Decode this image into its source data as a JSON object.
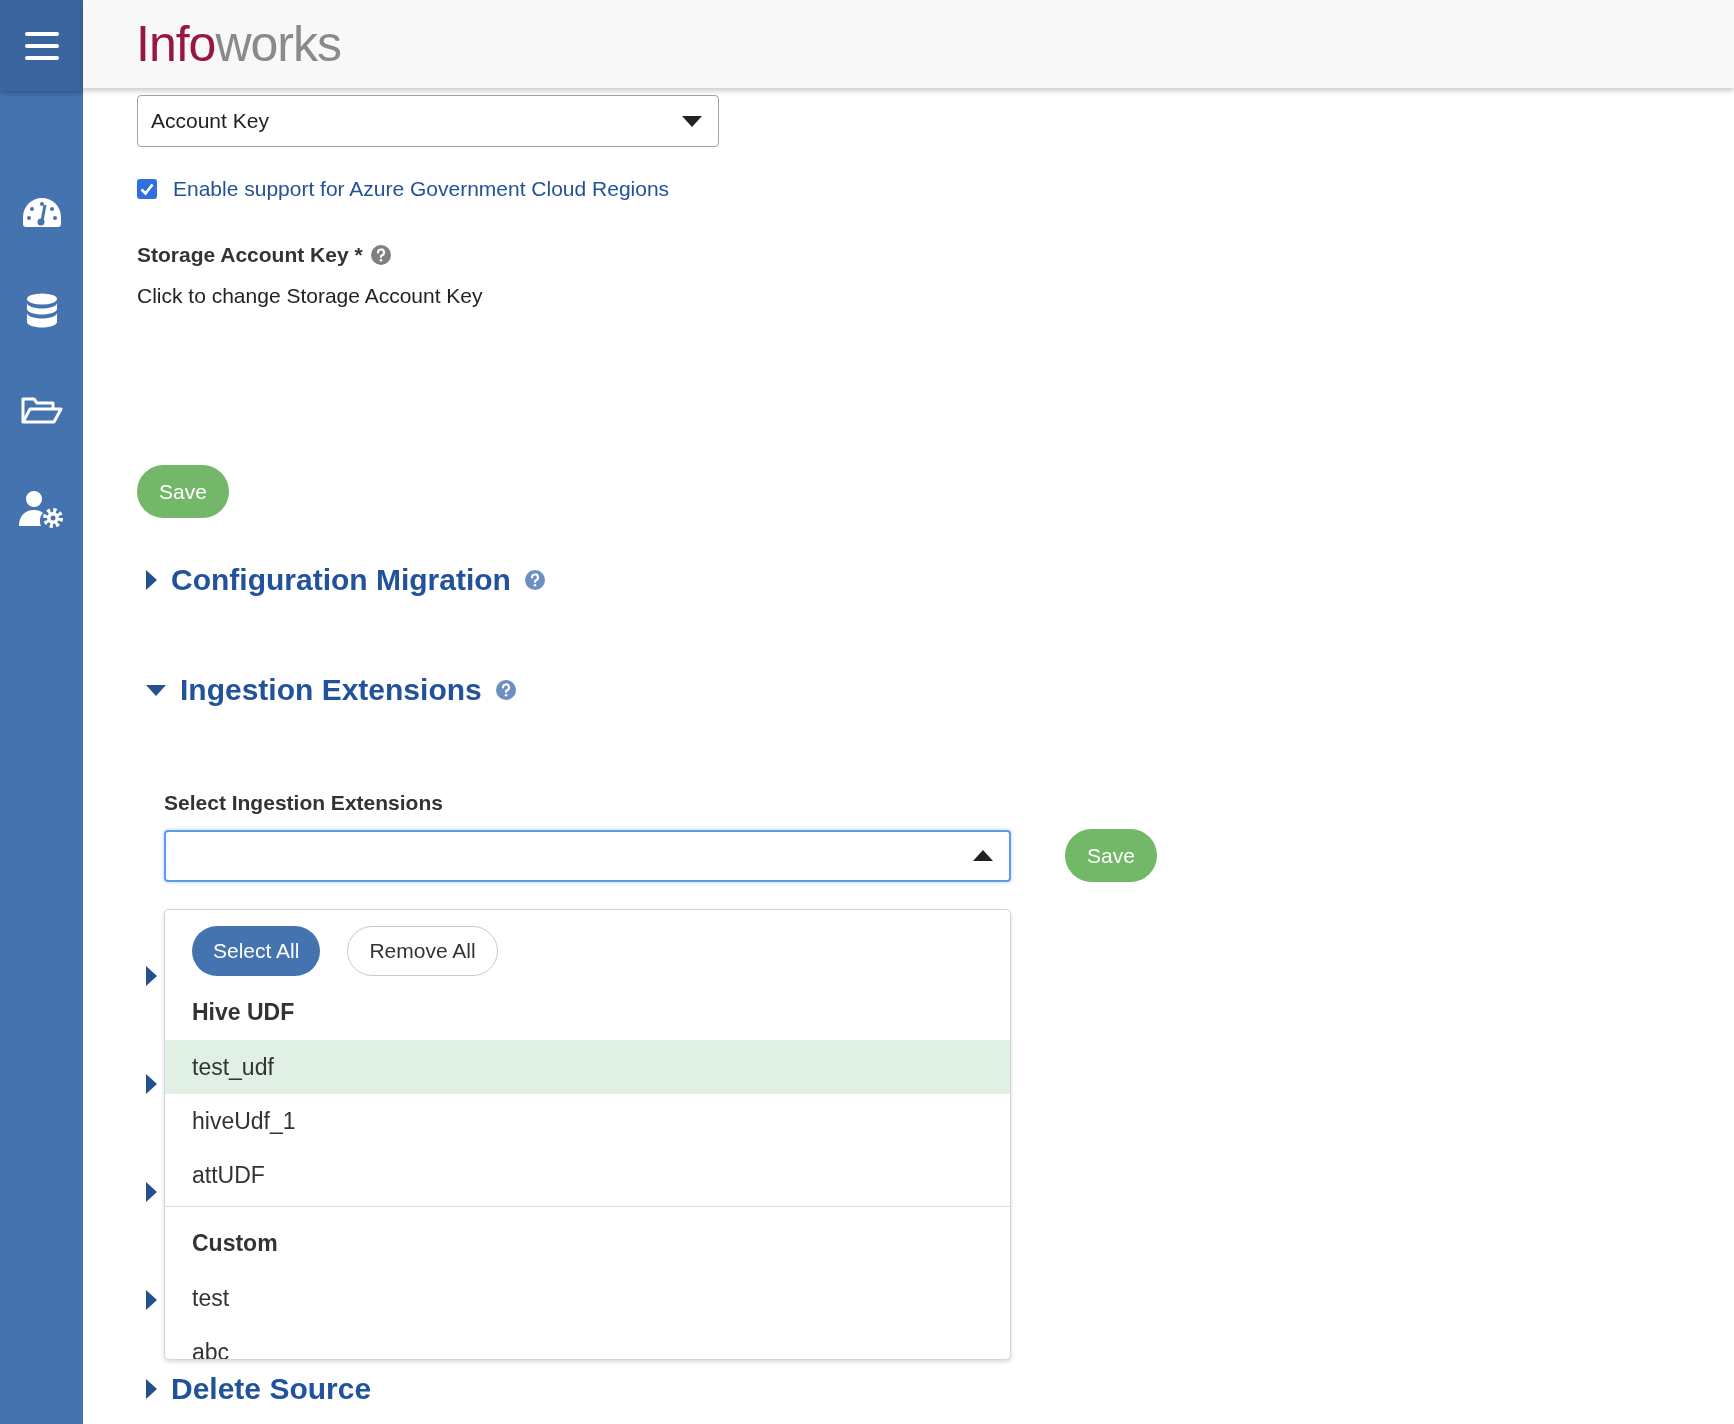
{
  "header": {
    "logo": {
      "part_1": "Info",
      "part_2": "works"
    }
  },
  "sidebar": {
    "items": [
      {
        "kind": "menu"
      },
      {
        "kind": "dashboard"
      },
      {
        "kind": "database"
      },
      {
        "kind": "folder"
      },
      {
        "kind": "user-settings"
      }
    ]
  },
  "auth_select": {
    "value": "Account Key"
  },
  "gov_cloud": {
    "label": "Enable support for Azure Government Cloud Regions",
    "checked": true
  },
  "storage_key": {
    "label": "Storage Account Key *",
    "link": "Click to change Storage Account Key"
  },
  "save_button": "Save",
  "sections": [
    {
      "title": "Configuration Migration",
      "expanded": false,
      "help": true
    },
    {
      "title": "Ingestion Extensions",
      "expanded": true,
      "help": true
    }
  ],
  "extensions": {
    "label": "Select Ingestion Extensions",
    "open": true,
    "save_button": "Save",
    "dropdown": {
      "select_all": "Select All",
      "remove_all": "Remove All",
      "groups": [
        {
          "title": "Hive UDF",
          "items": [
            {
              "label": "test_udf",
              "highlighted": true
            },
            {
              "label": "hiveUdf_1",
              "highlighted": false
            },
            {
              "label": "attUDF",
              "highlighted": false
            }
          ]
        },
        {
          "title": "Custom",
          "items": [
            {
              "label": "test",
              "highlighted": false
            },
            {
              "label": "abc",
              "highlighted": false
            }
          ]
        }
      ]
    }
  },
  "covered_sections": [
    {
      "expanded": false
    },
    {
      "expanded": false
    },
    {
      "expanded": false
    },
    {
      "expanded": false
    }
  ],
  "last_section": {
    "title": "Delete Source",
    "expanded": false
  }
}
